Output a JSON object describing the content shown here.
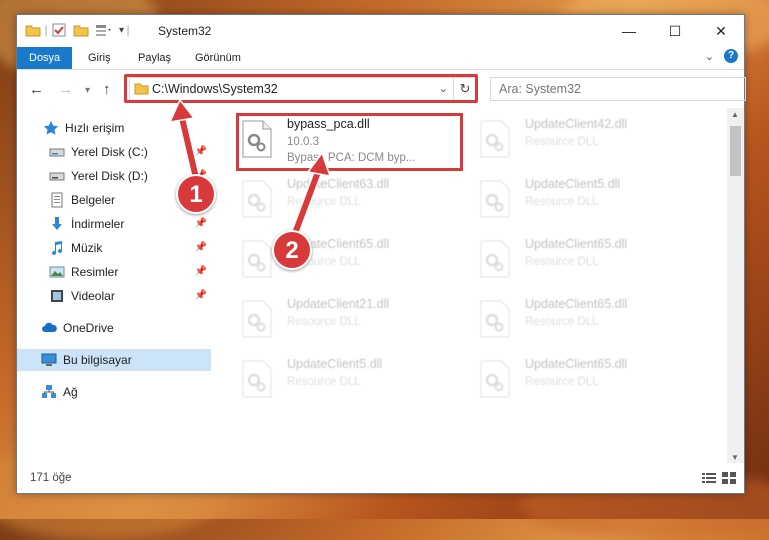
{
  "window": {
    "title": "System32",
    "controls": {
      "minimize": "—",
      "maximize": "☐",
      "close": "✕"
    }
  },
  "ribbon": {
    "tabs": [
      {
        "label": "Dosya",
        "active": true
      },
      {
        "label": "Giriş"
      },
      {
        "label": "Paylaş"
      },
      {
        "label": "Görünüm"
      }
    ]
  },
  "address": {
    "path": "C:\\Windows\\System32",
    "search_placeholder": "Ara: System32"
  },
  "navpane": {
    "items": [
      {
        "label": "Hızlı erişim",
        "icon": "star-icon"
      },
      {
        "label": "Yerel Disk (C:)",
        "icon": "drive-icon",
        "pinned": true
      },
      {
        "label": "Yerel Disk (D:)",
        "icon": "drive-icon",
        "pinned": true
      },
      {
        "label": "Belgeler",
        "icon": "documents-icon",
        "pinned": true
      },
      {
        "label": "İndirmeler",
        "icon": "download-icon",
        "pinned": true
      },
      {
        "label": "Müzik",
        "icon": "music-icon",
        "pinned": true
      },
      {
        "label": "Resimler",
        "icon": "pictures-icon",
        "pinned": true
      },
      {
        "label": "Videolar",
        "icon": "videos-icon",
        "pinned": true
      },
      {
        "label": "OneDrive",
        "icon": "cloud-icon"
      },
      {
        "label": "Bu bilgisayar",
        "icon": "computer-icon",
        "selected": true
      },
      {
        "label": "Ağ",
        "icon": "network-icon"
      }
    ]
  },
  "files": [
    {
      "name": "bypass_pca.dll",
      "line2": "10.0.3",
      "line3": "Bypass PCA: DCM byp...",
      "highlighted": true
    },
    {
      "name": "UpdateClient42.dll",
      "line2": "Resource DLL"
    },
    {
      "name": "UpdateClient63.dll",
      "line2": "Resource DLL"
    },
    {
      "name": "UpdateClient5.dll",
      "line2": "Resource DLL"
    },
    {
      "name": "UpdateClient65.dll",
      "line2": "Resource DLL"
    },
    {
      "name": "UpdateClient65.dll",
      "line2": "Resource DLL"
    },
    {
      "name": "UpdateClient21.dll",
      "line2": "Resource DLL"
    },
    {
      "name": "UpdateClient65.dll",
      "line2": "Resource DLL"
    },
    {
      "name": "UpdateClient5.dll",
      "line2": "Resource DLL"
    },
    {
      "name": "UpdateClient65.dll",
      "line2": "Resource DLL"
    }
  ],
  "status": {
    "count": "171 öğe"
  },
  "annotations": {
    "step1": "1",
    "step2": "2"
  },
  "colors": {
    "accent": "#1979ca",
    "highlight": "#d8393a"
  }
}
